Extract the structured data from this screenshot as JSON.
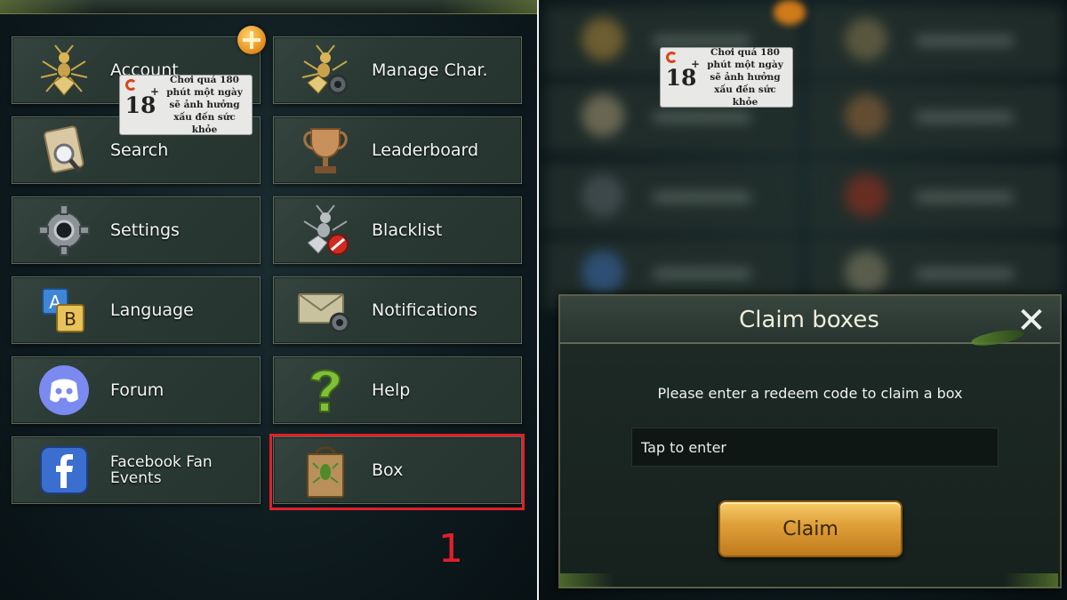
{
  "left": {
    "tiles": [
      {
        "label": "Account",
        "icon": "ant-icon"
      },
      {
        "label": "Manage Char.",
        "icon": "ant-gear-icon"
      },
      {
        "label": "Search",
        "icon": "scroll-magnifier-icon"
      },
      {
        "label": "Leaderboard",
        "icon": "trophy-icon"
      },
      {
        "label": "Settings",
        "icon": "gear-icon"
      },
      {
        "label": "Blacklist",
        "icon": "ant-block-icon"
      },
      {
        "label": "Language",
        "icon": "language-ab-icon"
      },
      {
        "label": "Notifications",
        "icon": "letter-gear-icon"
      },
      {
        "label": "Forum",
        "icon": "discord-icon"
      },
      {
        "label": "Help",
        "icon": "question-mark-icon"
      },
      {
        "label": "Facebook Fan Events",
        "icon": "facebook-icon"
      },
      {
        "label": "Box",
        "icon": "gift-bag-icon"
      }
    ],
    "age_badge": {
      "age": "18",
      "plus": "+",
      "warning": "Chơi quá 180 phút một ngày sẽ ảnh hưởng xấu đến sức khỏe"
    },
    "step_marker": "1"
  },
  "right": {
    "age_badge": {
      "age": "18",
      "plus": "+",
      "warning": "Chơi quá 180 phút một ngày sẽ ảnh hưởng xấu đến sức khỏe"
    },
    "dialog": {
      "title": "Claim boxes",
      "prompt": "Please enter a redeem code to claim a box",
      "input_placeholder": "Tap to enter",
      "claim_label": "Claim"
    }
  },
  "colors": {
    "highlight": "#e0202a",
    "claim_gold": "#e0a23a"
  }
}
